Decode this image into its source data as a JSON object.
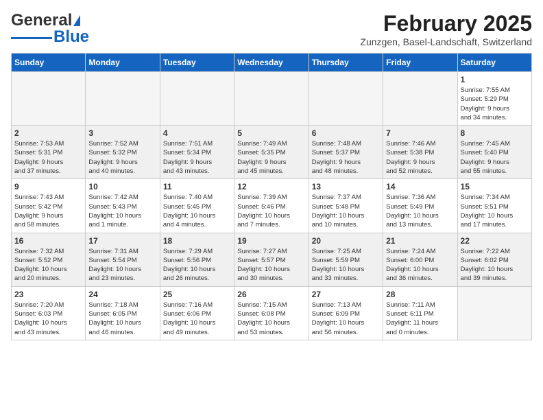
{
  "header": {
    "logo_general": "General",
    "logo_blue": "Blue",
    "month_year": "February 2025",
    "location": "Zunzgen, Basel-Landschaft, Switzerland"
  },
  "days_of_week": [
    "Sunday",
    "Monday",
    "Tuesday",
    "Wednesday",
    "Thursday",
    "Friday",
    "Saturday"
  ],
  "weeks": [
    [
      {
        "num": "",
        "info": ""
      },
      {
        "num": "",
        "info": ""
      },
      {
        "num": "",
        "info": ""
      },
      {
        "num": "",
        "info": ""
      },
      {
        "num": "",
        "info": ""
      },
      {
        "num": "",
        "info": ""
      },
      {
        "num": "1",
        "info": "Sunrise: 7:55 AM\nSunset: 5:29 PM\nDaylight: 9 hours\nand 34 minutes."
      }
    ],
    [
      {
        "num": "2",
        "info": "Sunrise: 7:53 AM\nSunset: 5:31 PM\nDaylight: 9 hours\nand 37 minutes."
      },
      {
        "num": "3",
        "info": "Sunrise: 7:52 AM\nSunset: 5:32 PM\nDaylight: 9 hours\nand 40 minutes."
      },
      {
        "num": "4",
        "info": "Sunrise: 7:51 AM\nSunset: 5:34 PM\nDaylight: 9 hours\nand 43 minutes."
      },
      {
        "num": "5",
        "info": "Sunrise: 7:49 AM\nSunset: 5:35 PM\nDaylight: 9 hours\nand 45 minutes."
      },
      {
        "num": "6",
        "info": "Sunrise: 7:48 AM\nSunset: 5:37 PM\nDaylight: 9 hours\nand 48 minutes."
      },
      {
        "num": "7",
        "info": "Sunrise: 7:46 AM\nSunset: 5:38 PM\nDaylight: 9 hours\nand 52 minutes."
      },
      {
        "num": "8",
        "info": "Sunrise: 7:45 AM\nSunset: 5:40 PM\nDaylight: 9 hours\nand 55 minutes."
      }
    ],
    [
      {
        "num": "9",
        "info": "Sunrise: 7:43 AM\nSunset: 5:42 PM\nDaylight: 9 hours\nand 58 minutes."
      },
      {
        "num": "10",
        "info": "Sunrise: 7:42 AM\nSunset: 5:43 PM\nDaylight: 10 hours\nand 1 minute."
      },
      {
        "num": "11",
        "info": "Sunrise: 7:40 AM\nSunset: 5:45 PM\nDaylight: 10 hours\nand 4 minutes."
      },
      {
        "num": "12",
        "info": "Sunrise: 7:39 AM\nSunset: 5:46 PM\nDaylight: 10 hours\nand 7 minutes."
      },
      {
        "num": "13",
        "info": "Sunrise: 7:37 AM\nSunset: 5:48 PM\nDaylight: 10 hours\nand 10 minutes."
      },
      {
        "num": "14",
        "info": "Sunrise: 7:36 AM\nSunset: 5:49 PM\nDaylight: 10 hours\nand 13 minutes."
      },
      {
        "num": "15",
        "info": "Sunrise: 7:34 AM\nSunset: 5:51 PM\nDaylight: 10 hours\nand 17 minutes."
      }
    ],
    [
      {
        "num": "16",
        "info": "Sunrise: 7:32 AM\nSunset: 5:52 PM\nDaylight: 10 hours\nand 20 minutes."
      },
      {
        "num": "17",
        "info": "Sunrise: 7:31 AM\nSunset: 5:54 PM\nDaylight: 10 hours\nand 23 minutes."
      },
      {
        "num": "18",
        "info": "Sunrise: 7:29 AM\nSunset: 5:56 PM\nDaylight: 10 hours\nand 26 minutes."
      },
      {
        "num": "19",
        "info": "Sunrise: 7:27 AM\nSunset: 5:57 PM\nDaylight: 10 hours\nand 30 minutes."
      },
      {
        "num": "20",
        "info": "Sunrise: 7:25 AM\nSunset: 5:59 PM\nDaylight: 10 hours\nand 33 minutes."
      },
      {
        "num": "21",
        "info": "Sunrise: 7:24 AM\nSunset: 6:00 PM\nDaylight: 10 hours\nand 36 minutes."
      },
      {
        "num": "22",
        "info": "Sunrise: 7:22 AM\nSunset: 6:02 PM\nDaylight: 10 hours\nand 39 minutes."
      }
    ],
    [
      {
        "num": "23",
        "info": "Sunrise: 7:20 AM\nSunset: 6:03 PM\nDaylight: 10 hours\nand 43 minutes."
      },
      {
        "num": "24",
        "info": "Sunrise: 7:18 AM\nSunset: 6:05 PM\nDaylight: 10 hours\nand 46 minutes."
      },
      {
        "num": "25",
        "info": "Sunrise: 7:16 AM\nSunset: 6:06 PM\nDaylight: 10 hours\nand 49 minutes."
      },
      {
        "num": "26",
        "info": "Sunrise: 7:15 AM\nSunset: 6:08 PM\nDaylight: 10 hours\nand 53 minutes."
      },
      {
        "num": "27",
        "info": "Sunrise: 7:13 AM\nSunset: 6:09 PM\nDaylight: 10 hours\nand 56 minutes."
      },
      {
        "num": "28",
        "info": "Sunrise: 7:11 AM\nSunset: 6:11 PM\nDaylight: 11 hours\nand 0 minutes."
      },
      {
        "num": "",
        "info": ""
      }
    ]
  ]
}
